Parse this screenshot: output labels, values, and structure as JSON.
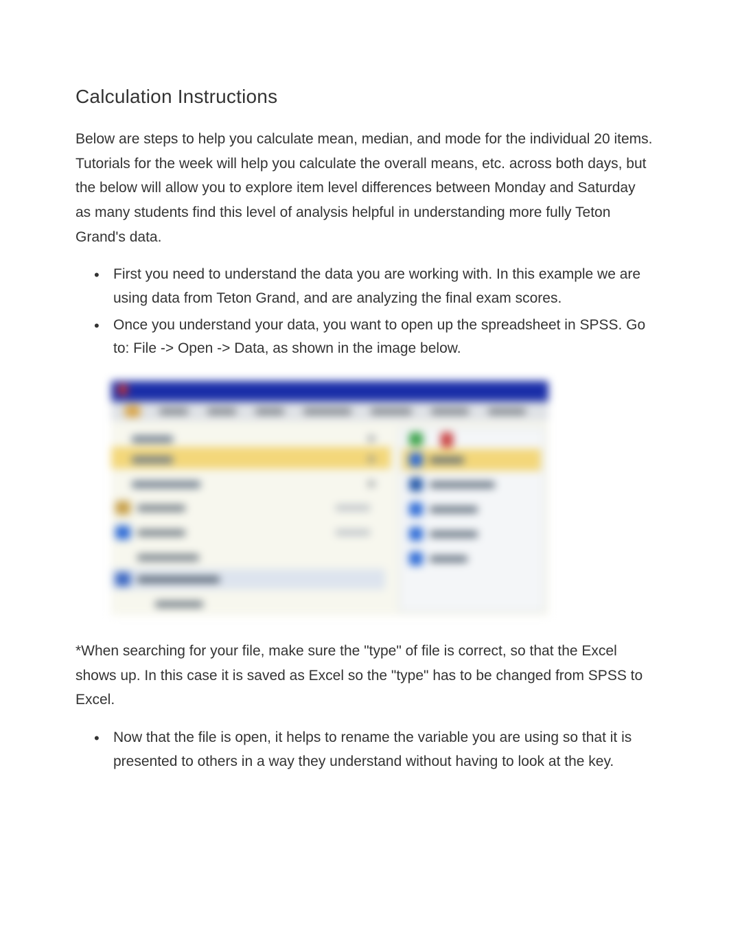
{
  "title": "Calculation Instructions",
  "intro": "Below are steps to help you calculate mean, median, and mode for the individual 20 items. Tutorials for the week will help you calculate the overall means, etc. across both days, but the below will allow you to explore item level differences between Monday and Saturday as many students find this level of analysis helpful in understanding more fully Teton Grand's data.",
  "bullets_top": [
    "First you need to understand the data you are working with. In this example we are using data from Teton Grand, and are analyzing the final exam scores.",
    "Once you understand your data, you want to open up the spreadsheet in SPSS. Go to:  File -> Open -> Data, as shown in the image below."
  ],
  "note": "*When searching for your file, make sure the \"type\" of file is correct, so that the Excel shows up. In this case it is saved as Excel so the \"type\" has to be changed from SPSS to Excel.",
  "bullets_bottom": [
    "Now that the file is open, it helps to rename the variable you are using so that it is presented to others in a way they understand without having to look at the key."
  ]
}
